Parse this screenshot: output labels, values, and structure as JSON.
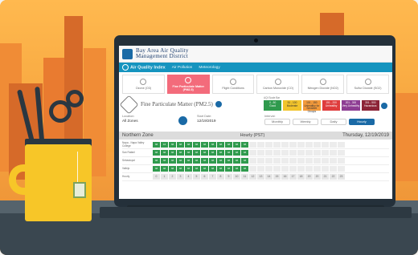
{
  "header": {
    "agency_line1": "Bay Area Air Quality",
    "agency_line2": "Management District"
  },
  "nav": {
    "items": [
      "Air Quality Index",
      "Air Pollution",
      "Meteorology"
    ]
  },
  "tiles": [
    {
      "label": "Ozone (O3)",
      "icon": "ozone-icon"
    },
    {
      "label": "Fine Particulate Matter (PM2.5)",
      "icon": "particle-icon"
    },
    {
      "label": "Flight Conditions",
      "icon": "plane-icon"
    },
    {
      "label": "Carbon Monoxide (CO)",
      "icon": "co-icon"
    },
    {
      "label": "Nitrogen Dioxide (NO2)",
      "icon": "no2-icon"
    },
    {
      "label": "Sulfur Dioxide (SO2)",
      "icon": "so2-icon"
    }
  ],
  "pollutant": {
    "title": "Fine Particulate Matter (PM2.5)"
  },
  "aqi_scale": {
    "title": "AQI Scale Bar",
    "levels": [
      {
        "range": "0 - 50",
        "label": "Good",
        "color": "#2f9a4d"
      },
      {
        "range": "51 - 100",
        "label": "Moderate",
        "color": "#f2c42c"
      },
      {
        "range": "101 - 150",
        "label": "Unhealthy for Sensitive Groups",
        "color": "#f39a3b"
      },
      {
        "range": "151 - 200",
        "label": "Unhealthy",
        "color": "#df3c3c"
      },
      {
        "range": "201 - 300",
        "label": "Very Unhealthy",
        "color": "#8d3d93"
      },
      {
        "range": "301 - 500",
        "label": "Hazardous",
        "color": "#8c2437"
      }
    ]
  },
  "controls": {
    "location_label": "Location:",
    "location_value": "All Zones",
    "date_label": "Start Date:",
    "date_value": "12/19/2019",
    "interval_label": "Interval:",
    "intervals": [
      "Monthly",
      "Weekly",
      "Daily",
      "Hourly"
    ]
  },
  "zone": {
    "name": "Northern Zone",
    "timezone": "Hourly (PST)",
    "date": "Thursday, 12/19/2019"
  },
  "stations": [
    {
      "name": "Napa - Napa Valley College",
      "values": [
        "38",
        "43",
        "38",
        "38",
        "38",
        "38",
        "38",
        "38",
        "38",
        "38",
        "38",
        "38"
      ]
    },
    {
      "name": "San Rafael",
      "values": [
        "38",
        "38",
        "38",
        "38",
        "38",
        "38",
        "38",
        "38",
        "38",
        "38",
        "38",
        "38"
      ]
    },
    {
      "name": "Sebastopol",
      "values": [
        "38",
        "38",
        "38",
        "38",
        "38",
        "38",
        "38",
        "38",
        "38",
        "38",
        "38",
        "38"
      ]
    },
    {
      "name": "Vallejo",
      "values": [
        "38",
        "38",
        "38",
        "38",
        "38",
        "38",
        "38",
        "38",
        "38",
        "38",
        "38",
        "38"
      ]
    }
  ],
  "hours_label": "Hourly",
  "hours": [
    "0",
    "1",
    "2",
    "3",
    "4",
    "5",
    "6",
    "7",
    "8",
    "9",
    "10",
    "11",
    "12",
    "13",
    "14",
    "15",
    "16",
    "17",
    "18",
    "19",
    "20",
    "21",
    "22",
    "23"
  ],
  "colors": {
    "nav": "#1594bf",
    "active_tile": "#f36b7b",
    "good": "#2f9a4d",
    "mug": "#f7c628",
    "background": "#f6a23f"
  }
}
